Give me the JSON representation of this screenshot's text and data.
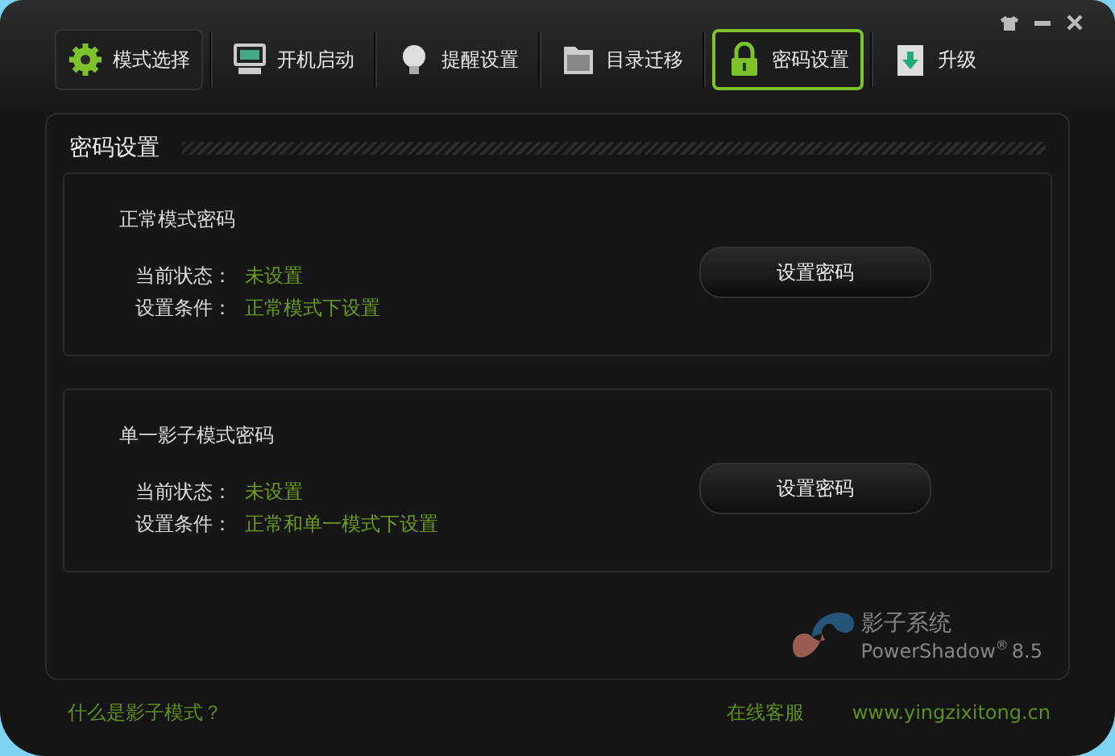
{
  "tabs": [
    {
      "label": "模式选择",
      "selected": false,
      "hovered": true
    },
    {
      "label": "开机启动",
      "selected": false,
      "hovered": false
    },
    {
      "label": "提醒设置",
      "selected": false,
      "hovered": false
    },
    {
      "label": "目录迁移",
      "selected": false,
      "hovered": false
    },
    {
      "label": "密码设置",
      "selected": true,
      "hovered": false
    },
    {
      "label": "升级",
      "selected": false,
      "hovered": false
    }
  ],
  "section_title": "密码设置",
  "groups": [
    {
      "title": "正常模式密码",
      "rows": [
        {
          "label": "当前状态：",
          "value": "未设置"
        },
        {
          "label": "设置条件：",
          "value": "正常模式下设置"
        }
      ],
      "button": "设置密码"
    },
    {
      "title": "单一影子模式密码",
      "rows": [
        {
          "label": "当前状态：",
          "value": "未设置"
        },
        {
          "label": "设置条件：",
          "value": "正常和单一模式下设置"
        }
      ],
      "button": "设置密码"
    }
  ],
  "brand": {
    "name": "影子系统",
    "product": "PowerShadow",
    "mark": "®",
    "version": "8.5"
  },
  "footer": {
    "help_link": "什么是影子模式？",
    "service_link": "在线客服",
    "website": "www.yingzixitong.cn"
  }
}
